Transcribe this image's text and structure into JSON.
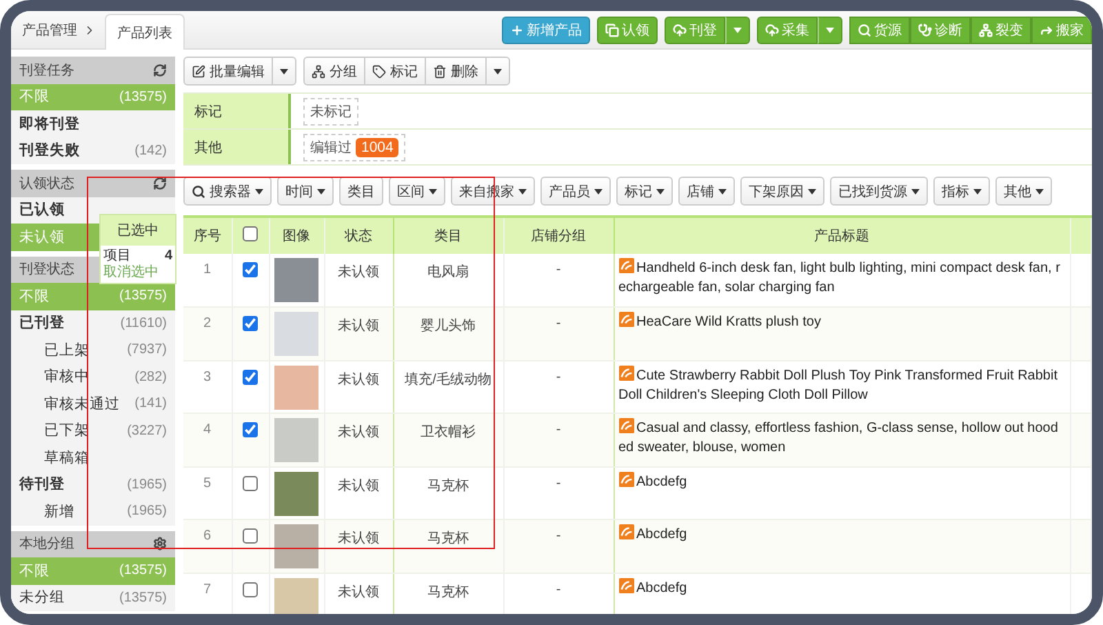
{
  "breadcrumb": {
    "parent": "产品管理"
  },
  "tabs": [
    {
      "label": "产品列表",
      "selected": true
    }
  ],
  "top_actions": [
    {
      "kind": "primary",
      "label": "新增产品"
    },
    {
      "kind": "success",
      "label": "认领"
    },
    {
      "kind": "split",
      "label": "刊登"
    },
    {
      "kind": "split",
      "label": "采集"
    }
  ],
  "tool_group": [
    "货源",
    "诊断",
    "裂变",
    "搬家"
  ],
  "sidebar": {
    "sections": [
      {
        "title": "刊登任务",
        "items": [
          {
            "label": "不限",
            "count": "(13575)",
            "selected": true,
            "bold": false
          },
          {
            "label": "即将刊登",
            "selected": false,
            "bold": true
          },
          {
            "label": "刊登失败",
            "count": "(142)",
            "selected": false,
            "bold": true
          }
        ]
      },
      {
        "title": "认领状态",
        "items": [
          {
            "label": "已认领",
            "selected": false,
            "bold": true
          },
          {
            "label": "未认领",
            "selected": true,
            "bold": false
          }
        ]
      },
      {
        "title": "刊登状态",
        "items": [
          {
            "label": "不限",
            "count": "(13575)",
            "selected": true,
            "bold": false
          },
          {
            "label": "已刊登",
            "count": "(11610)",
            "selected": false,
            "bold": true,
            "children": [
              {
                "label": "已上架",
                "count": "(7937)",
                "selected": false,
                "bold": false
              },
              {
                "label": "审核中",
                "count": "(282)",
                "selected": false,
                "bold": false
              },
              {
                "label": "审核未通过",
                "count": "(141)",
                "selected": false,
                "bold": false
              },
              {
                "label": "已下架",
                "count": "(3227)",
                "selected": false,
                "bold": false
              },
              {
                "label": "草稿箱",
                "selected": false,
                "bold": false
              }
            ]
          },
          {
            "label": "待刊登",
            "count": "(1965)",
            "selected": false,
            "bold": true,
            "children": [
              {
                "label": "新增",
                "count": "(1965)",
                "selected": false,
                "bold": false
              }
            ]
          }
        ]
      },
      {
        "title": "本地分组",
        "items": [
          {
            "label": "不限",
            "count": "(13575)",
            "selected": true,
            "bold": false
          },
          {
            "label": "未分组",
            "count": "(13575)",
            "selected": false,
            "bold": false
          }
        ]
      }
    ]
  },
  "toolbar": {
    "batch_edit": "批量编辑",
    "group": [
      "分组",
      "标记",
      "删除"
    ]
  },
  "filter_panel": [
    {
      "label": "标记",
      "chips": [
        {
          "label": "未标记"
        }
      ]
    },
    {
      "label": "其他",
      "chips": [
        {
          "label": "编辑过",
          "badge": "1004"
        }
      ]
    }
  ],
  "filters": [
    {
      "label": "搜索器",
      "dropdown": true
    },
    {
      "label": "时间",
      "dropdown": true
    },
    {
      "label": "类目",
      "dropdown": false
    },
    {
      "label": "区间",
      "dropdown": true
    },
    {
      "label": "来自搬家",
      "dropdown": true
    },
    {
      "label": "产品员",
      "dropdown": true
    },
    {
      "label": "标记",
      "dropdown": true
    },
    {
      "label": "店铺",
      "dropdown": true
    },
    {
      "label": "下架原因",
      "dropdown": true
    },
    {
      "label": "已找到货源",
      "dropdown": true
    },
    {
      "label": "指标",
      "dropdown": true
    },
    {
      "label": "其他",
      "dropdown": true
    }
  ],
  "table": {
    "columns": [
      {
        "kind": "text",
        "label": "序号"
      },
      {
        "kind": "checkbox",
        "checked": false
      },
      {
        "kind": "text",
        "label": "图像"
      },
      {
        "kind": "text",
        "label": "状态"
      },
      {
        "kind": "text",
        "label": "类目"
      },
      {
        "kind": "text",
        "label": "店铺分组"
      },
      {
        "kind": "text",
        "label": "产品标题"
      }
    ],
    "rows": [
      {
        "index": "1",
        "checked": true,
        "status": "未认领",
        "category": "电风扇",
        "shop_group": "-",
        "title": "Handheld 6-inch desk fan, light bulb lighting, mini compact desk fan, rechargeable fan, solar charging fan"
      },
      {
        "index": "2",
        "checked": true,
        "status": "未认领",
        "category": "婴儿头饰",
        "shop_group": "-",
        "title": "HeaCare Wild Kratts plush toy"
      },
      {
        "index": "3",
        "checked": true,
        "status": "未认领",
        "category": "填充/毛绒动物",
        "shop_group": "-",
        "title": "Cute Strawberry Rabbit Doll Plush Toy Pink Transformed Fruit Rabbit Doll Children's Sleeping Cloth Doll Pillow"
      },
      {
        "index": "4",
        "checked": true,
        "status": "未认领",
        "category": "卫衣帽衫",
        "shop_group": "-",
        "title": "Casual and classy, effortless fashion, G-class sense, hollow out hooded sweater, blouse, women"
      },
      {
        "index": "5",
        "checked": false,
        "status": "未认领",
        "category": "马克杯",
        "shop_group": "-",
        "title": "Abcdefg"
      },
      {
        "index": "6",
        "checked": false,
        "status": "未认领",
        "category": "马克杯",
        "shop_group": "-",
        "title": "Abcdefg"
      },
      {
        "index": "7",
        "checked": false,
        "status": "未认领",
        "category": "马克杯",
        "shop_group": "-",
        "title": "Abcdefg"
      }
    ]
  },
  "selection_popup": {
    "title": "已选中",
    "label": "项目",
    "count": "4",
    "action": "取消选中"
  }
}
